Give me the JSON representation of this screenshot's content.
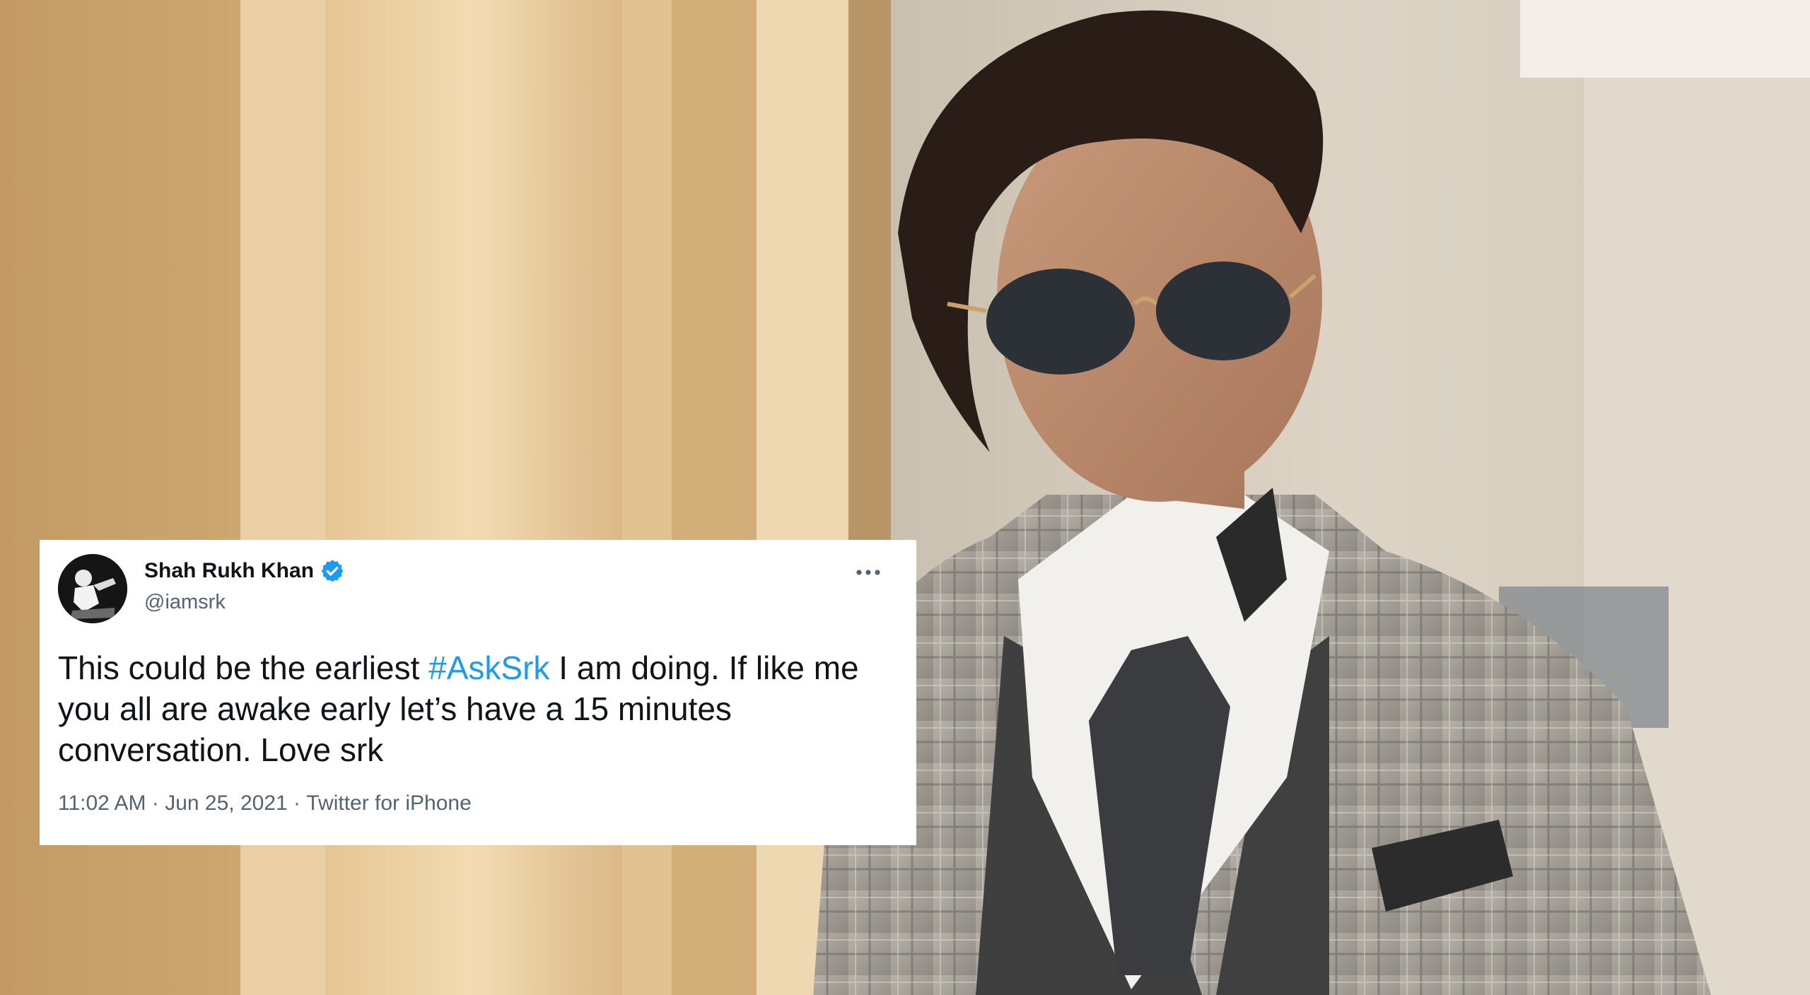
{
  "tweet": {
    "display_name": "Shah Rukh Khan",
    "handle": "@iamsrk",
    "text_before": "This could be the earliest ",
    "hashtag": "#AskSrk",
    "text_after": " I am doing. If like me you all are awake early let’s have a 15 minutes conversation. Love srk",
    "time": "11:02 AM",
    "separator": " · ",
    "date": "Jun 25, 2021",
    "source": "Twitter for iPhone",
    "icons": {
      "verified": "verified-badge-icon",
      "more": "more-options-icon"
    }
  },
  "colors": {
    "hashtag": "#1d9bf0",
    "verified": "#1d9bf0",
    "text": "#0f1419",
    "secondary": "#536471"
  }
}
